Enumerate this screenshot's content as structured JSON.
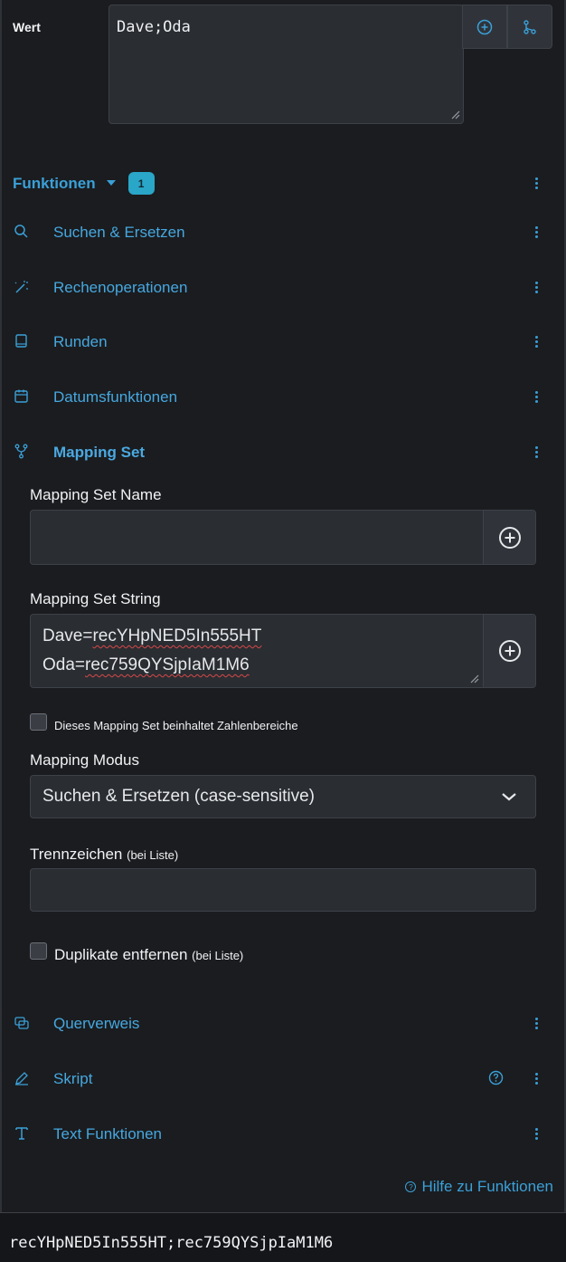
{
  "wert": {
    "label": "Wert",
    "value": "Dave;Oda",
    "add_icon": "plus-circle-icon",
    "branch_icon": "git-branch-icon"
  },
  "functions": {
    "title": "Funktionen",
    "count": "1",
    "items": [
      {
        "label": "Suchen & Ersetzen",
        "icon": "search-icon"
      },
      {
        "label": "Rechenoperationen",
        "icon": "magic-wand-icon"
      },
      {
        "label": "Runden",
        "icon": "book-icon"
      },
      {
        "label": "Datumsfunktionen",
        "icon": "calendar-icon"
      },
      {
        "label": "Mapping Set",
        "icon": "fork-icon"
      },
      {
        "label": "Querverweis",
        "icon": "cross-reference-icon"
      },
      {
        "label": "Skript",
        "icon": "pencil-icon"
      },
      {
        "label": "Text Funktionen",
        "icon": "text-icon"
      }
    ]
  },
  "mapping_set": {
    "name_label": "Mapping Set Name",
    "name_value": "",
    "string_label": "Mapping Set String",
    "string_lines": [
      {
        "key": "Dave=",
        "value": "recYHpNED5In555HT"
      },
      {
        "key": "Oda=",
        "value": "rec759QYSjpIaM1M6"
      }
    ],
    "ranges_checkbox_label": "Dieses Mapping Set beinhaltet Zahlenbereiche",
    "ranges_checked": false,
    "mode_label": "Mapping Modus",
    "mode_value": "Suchen & Ersetzen (case-sensitive)",
    "separator_label": "Trennzeichen",
    "separator_hint": "(bei Liste)",
    "separator_value": "",
    "dedupe_label": "Duplikate entfernen",
    "dedupe_hint": "(bei Liste)",
    "dedupe_checked": false
  },
  "help_link": "Hilfe zu Funktionen",
  "result": "recYHpNED5In555HT;rec759QYSjpIaM1M6",
  "colors": {
    "accent": "#3aa0d8",
    "badge": "#2aa6c8",
    "background": "#1b1c1f",
    "input": "#2a2d32"
  }
}
